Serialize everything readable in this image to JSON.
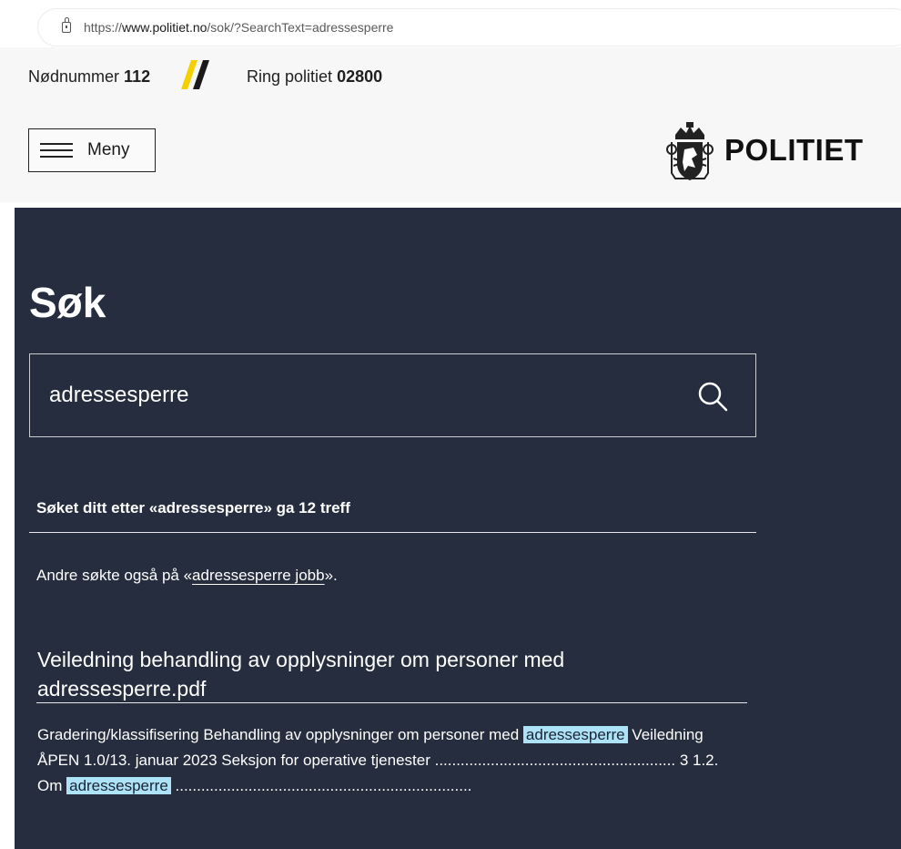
{
  "browser": {
    "url_prefix": "https://",
    "url_host": "www.politiet.no",
    "url_path": "/sok/?SearchText=adressesperre"
  },
  "emergency": {
    "emergency_label": "Nødnummer",
    "emergency_number": "112",
    "call_label": "Ring politiet",
    "call_number": "02800",
    "accent_color": "#f5d000"
  },
  "header": {
    "menu_label": "Meny",
    "brand": "POLITIET"
  },
  "search": {
    "heading": "Søk",
    "value": "adressesperre",
    "summary": "Søket ditt etter «adressesperre» ga 12 treff",
    "also_prefix": "Andre søkte også på «",
    "also_link": "adressesperre jobb",
    "also_suffix": "»."
  },
  "results": [
    {
      "title": "Veiledning behandling av opplysninger om personer med adressesperre.pdf",
      "snippet": {
        "p1": "Gradering/klassifisering Behandling av opplysninger om personer med ",
        "h1": "adressesperre",
        "p2": " Veiledning ÅPEN 1.0/13. januar 2023 Seksjon for operative tjenester ........................................................ 3 1.2. Om ",
        "h2": "adressesperre",
        "p3": " ....................................................................."
      }
    }
  ],
  "colors": {
    "dark_background": "#252d3e",
    "highlight": "#aee3f7"
  }
}
